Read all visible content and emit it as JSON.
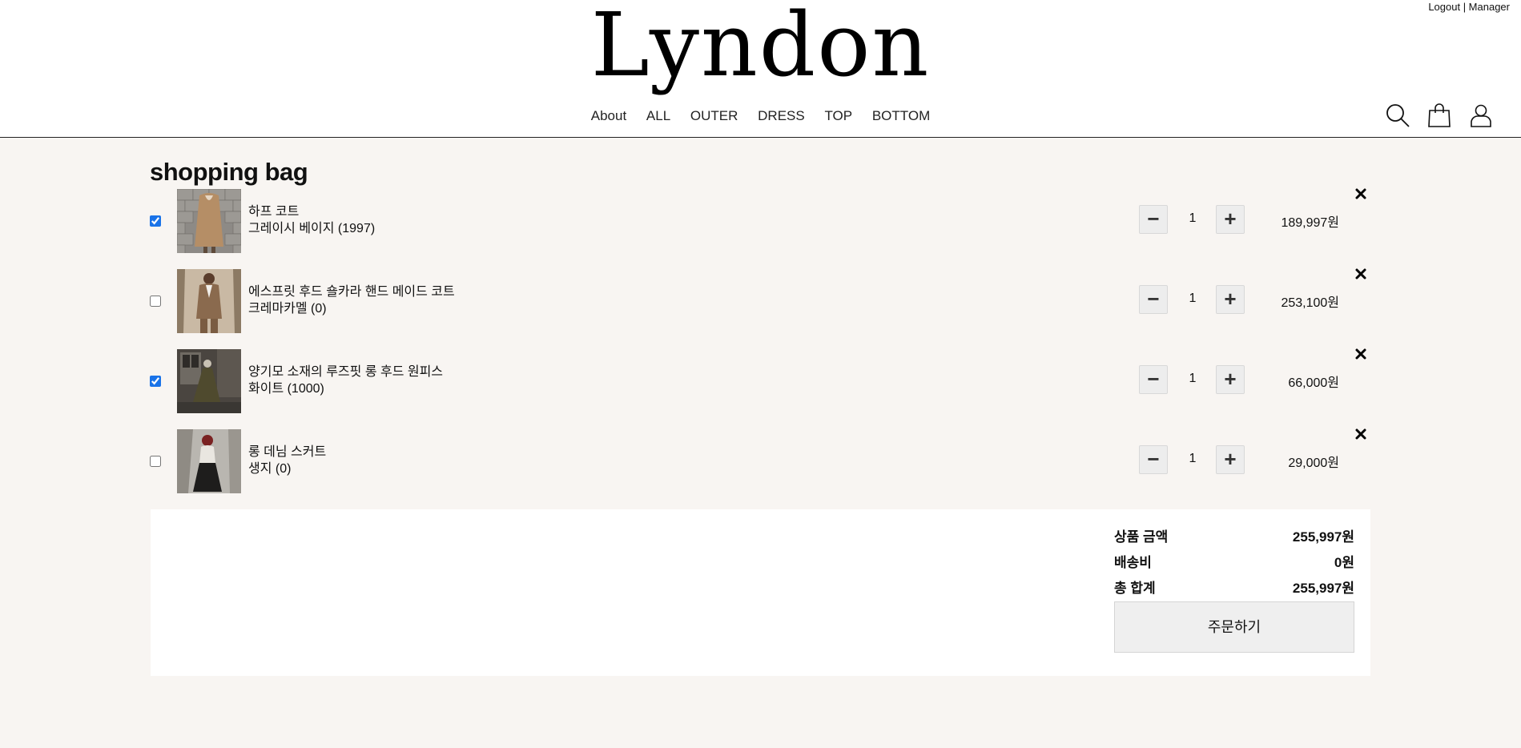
{
  "header": {
    "brand": "Lyndon",
    "user_links": {
      "logout": "Logout",
      "manager": " | Manager"
    },
    "nav": [
      "About",
      "ALL",
      "OUTER",
      "DRESS",
      "TOP",
      "BOTTOM"
    ],
    "icons": [
      "search-icon",
      "shopping-bag-icon",
      "user-icon"
    ]
  },
  "cart": {
    "title": "shopping bag",
    "items": [
      {
        "name": "하프 코트",
        "option": "그레이시 베이지 (1997)",
        "qty": "1",
        "price": "189,997원",
        "checked": true
      },
      {
        "name": "에스프릿 후드 숄카라 핸드 메이드 코트",
        "option": "크레마카멜 (0)",
        "qty": "1",
        "price": "253,100원",
        "checked": false
      },
      {
        "name": "양기모 소재의 루즈핏 롱 후드 원피스",
        "option": "화이트 (1000)",
        "qty": "1",
        "price": "66,000원",
        "checked": true
      },
      {
        "name": "롱 데님 스커트",
        "option": "생지 (0)",
        "qty": "1",
        "price": "29,000원",
        "checked": false
      }
    ],
    "minus_label": "−",
    "plus_label": "+"
  },
  "summary": {
    "subtotal_label": "상품 금액",
    "subtotal_value": "255,997원",
    "shipping_label": "배송비",
    "shipping_value": "0원",
    "total_label": "총 합계",
    "total_value": "255,997원",
    "order_button": "주문하기"
  },
  "colors": {
    "accent": "#1a73e8",
    "page_bg": "#f8f5f2",
    "header_bg": "#ffffff"
  }
}
